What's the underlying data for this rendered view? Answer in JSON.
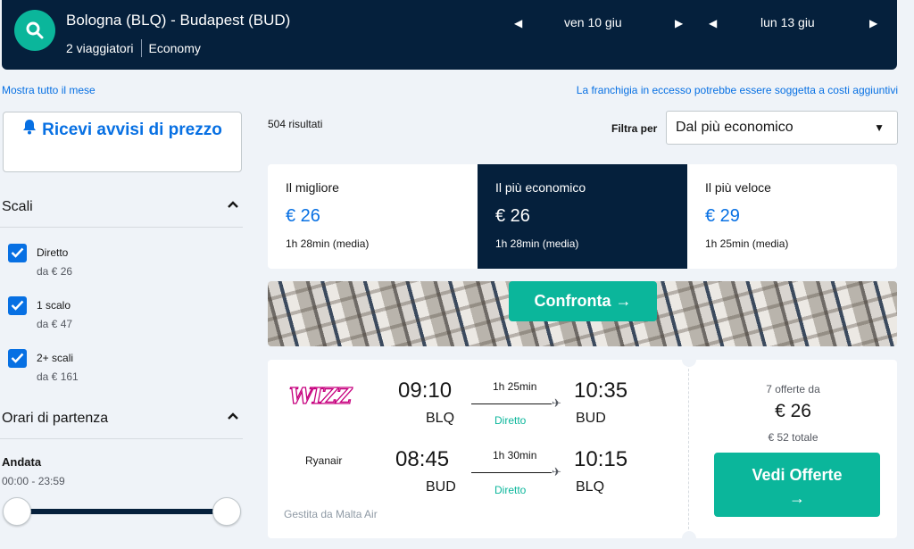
{
  "header": {
    "route": "Bologna (BLQ) - Budapest (BUD)",
    "travellers": "2 viaggiatori",
    "cabin": "Economy",
    "outbound_date": "ven 10 giu",
    "return_date": "lun 13 giu"
  },
  "links": {
    "show_month": "Mostra tutto il mese",
    "baggage_notice": "La franchigia in eccesso potrebbe essere soggetta a costi aggiuntivi"
  },
  "sidebar": {
    "alert_button": "Ricevi avvisi di prezzo",
    "stops_title": "Scali",
    "stops": [
      {
        "label": "Diretto",
        "price": "da € 26",
        "checked": true
      },
      {
        "label": "1 scalo",
        "price": "da € 47",
        "checked": true
      },
      {
        "label": "2+ scali",
        "price": "da € 161",
        "checked": true
      }
    ],
    "departure_title": "Orari di partenza",
    "outbound_label": "Andata",
    "outbound_range": "00:00 - 23:59"
  },
  "results": {
    "count": "504 risultati",
    "filter_label": "Filtra per",
    "filter_value": "Dal più economico"
  },
  "sort_tabs": [
    {
      "label": "Il migliore",
      "price": "€ 26",
      "duration": "1h 28min (media)",
      "active": false
    },
    {
      "label": "Il più economico",
      "price": "€ 26",
      "duration": "1h 28min (media)",
      "active": true
    },
    {
      "label": "Il più veloce",
      "price": "€ 29",
      "duration": "1h 25min (media)",
      "active": false
    }
  ],
  "banner": {
    "compare_button": "Confronta →"
  },
  "flight_card": {
    "outbound": {
      "airline": "wizz",
      "depart_time": "09:10",
      "depart_airport": "BLQ",
      "duration": "1h 25min",
      "stops": "Diretto",
      "arrive_time": "10:35",
      "arrive_airport": "BUD"
    },
    "return": {
      "airline": "Ryanair",
      "depart_time": "08:45",
      "depart_airport": "BUD",
      "duration": "1h 30min",
      "stops": "Diretto",
      "arrive_time": "10:15",
      "arrive_airport": "BLQ"
    },
    "operated_by": "Gestita da Malta Air",
    "offers_count": "7 offerte da",
    "price": "€ 26",
    "total": "€ 52 totale",
    "cta_label": "Vedi Offerte",
    "cta_arrow": "→"
  },
  "colors": {
    "navy": "#05203c",
    "teal": "#0bb69b",
    "blue": "#0770e3"
  }
}
